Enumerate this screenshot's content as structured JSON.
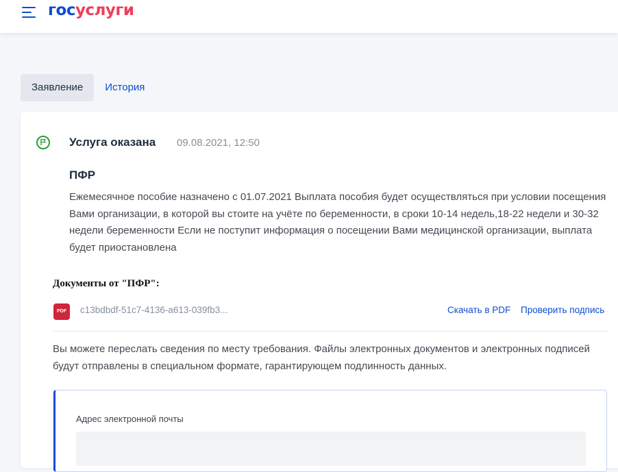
{
  "header": {
    "logo_part1": "гос",
    "logo_part2": "услуги",
    "brand_blue": "#0d4cd3",
    "brand_red": "#ee3f58"
  },
  "tabs": [
    {
      "label": "Заявление",
      "active": true
    },
    {
      "label": "История",
      "active": false
    }
  ],
  "status": {
    "icon": "flag-icon",
    "title": "Услуга оказана",
    "datetime": "09.08.2021, 12:50",
    "icon_color": "#2a9d3a"
  },
  "message": {
    "org": "ПФР",
    "text": "Ежемесячное пособие назначено с 01.07.2021 Выплата пособия будет осуществляться при условии посещения Вами организации, в которой вы стоите на учёте по беременности, в сроки 10-14 недель,18-22 недели и 30-32 недели беременности Если не поступит информация о посещении Вами медицинской организации, выплата будет приостановлена"
  },
  "documents": {
    "label": "Документы от \"ПФР\":",
    "items": [
      {
        "badge": "PDF",
        "name": "c13bdbdf-51c7-4136-a613-039fb3...",
        "download_label": "Скачать в PDF",
        "verify_label": "Проверить подпись"
      }
    ]
  },
  "forward": {
    "text": "Вы можете переслать сведения по месту требования. Файлы электронных документов и электронных подписей будут отправлены в специальном формате, гарантирующем подлинность данных.",
    "email_label": "Адрес электронной почты",
    "email_value": ""
  }
}
